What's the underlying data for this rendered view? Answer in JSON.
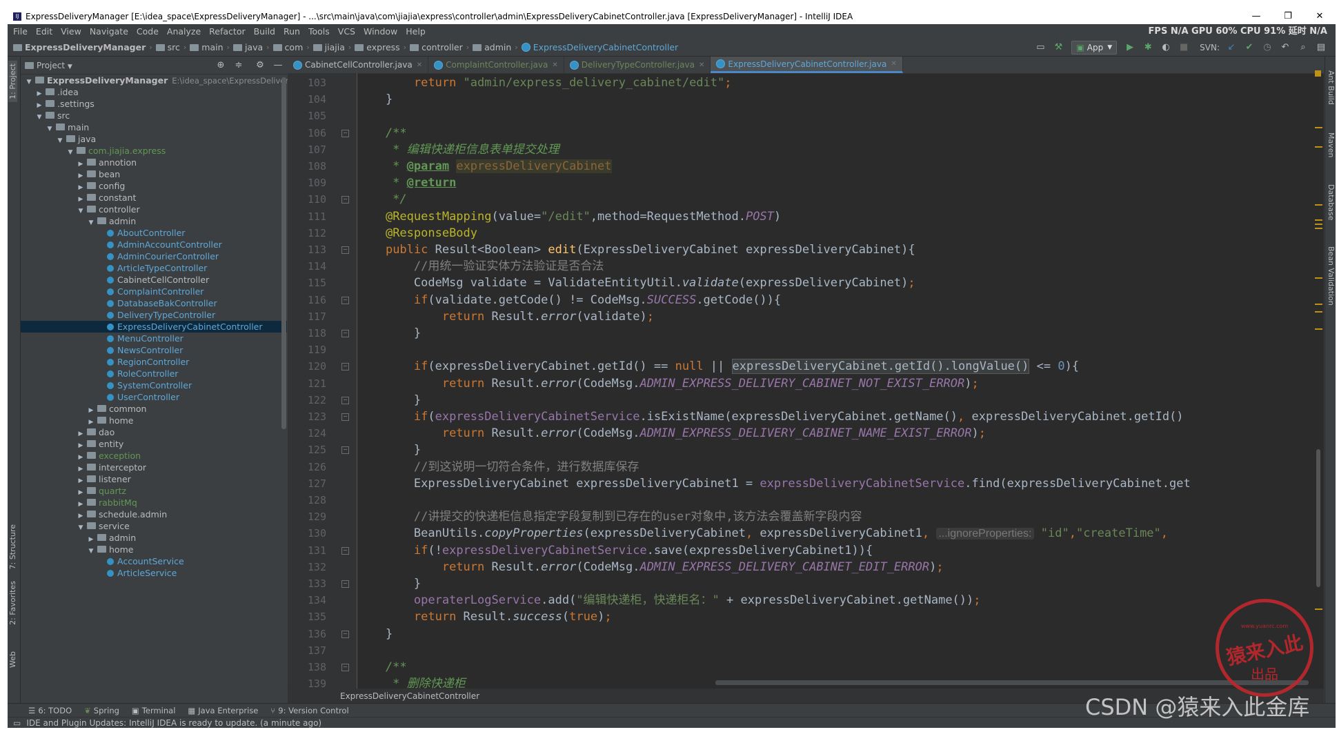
{
  "window": {
    "title": "ExpressDeliveryManager [E:\\idea_space\\ExpressDeliveryManager] - ...\\src\\main\\java\\com\\jiajia\\express\\controller\\admin\\ExpressDeliveryCabinetController.java [ExpressDeliveryManager] - IntelliJ IDEA",
    "controls": [
      "—",
      "❐",
      "✕"
    ]
  },
  "menu": [
    "File",
    "Edit",
    "View",
    "Navigate",
    "Code",
    "Analyze",
    "Refactor",
    "Build",
    "Run",
    "Tools",
    "VCS",
    "Window",
    "Help"
  ],
  "perf": "FPS N/A GPU 60% CPU 91% 延时 N/A",
  "nav": {
    "crumbs": [
      "ExpressDeliveryManager",
      "src",
      "main",
      "java",
      "com",
      "jiajia",
      "express",
      "controller",
      "admin",
      "ExpressDeliveryCabinetController"
    ],
    "run_config": "App",
    "svn_label": "SVN:"
  },
  "project": {
    "title": "Project",
    "tree": [
      {
        "level": 0,
        "label": "ExpressDeliveryManager",
        "extra": "E:\\idea_space\\ExpressDeliveryManager",
        "kind": "module",
        "open": true
      },
      {
        "level": 1,
        "label": ".idea",
        "kind": "folder",
        "open": false
      },
      {
        "level": 1,
        "label": ".settings",
        "kind": "folder",
        "open": false
      },
      {
        "level": 1,
        "label": "src",
        "kind": "folder",
        "open": true
      },
      {
        "level": 2,
        "label": "main",
        "kind": "folder",
        "open": true
      },
      {
        "level": 3,
        "label": "java",
        "kind": "folder",
        "open": true
      },
      {
        "level": 4,
        "label": "com.jiajia.express",
        "kind": "package",
        "open": true,
        "color": "green"
      },
      {
        "level": 5,
        "label": "annotion",
        "kind": "folder",
        "open": false
      },
      {
        "level": 5,
        "label": "bean",
        "kind": "folder",
        "open": false
      },
      {
        "level": 5,
        "label": "config",
        "kind": "folder",
        "open": false
      },
      {
        "level": 5,
        "label": "constant",
        "kind": "folder",
        "open": false
      },
      {
        "level": 5,
        "label": "controller",
        "kind": "folder",
        "open": true
      },
      {
        "level": 6,
        "label": "admin",
        "kind": "folder",
        "open": true
      },
      {
        "level": 7,
        "label": "AboutController",
        "kind": "class",
        "color": "green"
      },
      {
        "level": 7,
        "label": "AdminAccountController",
        "kind": "class",
        "color": "green"
      },
      {
        "level": 7,
        "label": "AdminCourierController",
        "kind": "class",
        "color": "green"
      },
      {
        "level": 7,
        "label": "ArticleTypeController",
        "kind": "class",
        "color": "green"
      },
      {
        "level": 7,
        "label": "CabinetCellController",
        "kind": "class",
        "color": "plain"
      },
      {
        "level": 7,
        "label": "ComplaintController",
        "kind": "class",
        "color": "green"
      },
      {
        "level": 7,
        "label": "DatabaseBakController",
        "kind": "class",
        "color": "green"
      },
      {
        "level": 7,
        "label": "DeliveryTypeController",
        "kind": "class",
        "color": "green"
      },
      {
        "level": 7,
        "label": "ExpressDeliveryCabinetController",
        "kind": "class",
        "color": "green",
        "selected": true
      },
      {
        "level": 7,
        "label": "MenuController",
        "kind": "class",
        "color": "green"
      },
      {
        "level": 7,
        "label": "NewsController",
        "kind": "class",
        "color": "green"
      },
      {
        "level": 7,
        "label": "RegionController",
        "kind": "class",
        "color": "green"
      },
      {
        "level": 7,
        "label": "RoleController",
        "kind": "class",
        "color": "green"
      },
      {
        "level": 7,
        "label": "SystemController",
        "kind": "class",
        "color": "green"
      },
      {
        "level": 7,
        "label": "UserController",
        "kind": "class",
        "color": "green"
      },
      {
        "level": 6,
        "label": "common",
        "kind": "folder",
        "open": false
      },
      {
        "level": 6,
        "label": "home",
        "kind": "folder",
        "open": false
      },
      {
        "level": 5,
        "label": "dao",
        "kind": "folder",
        "open": false
      },
      {
        "level": 5,
        "label": "entity",
        "kind": "folder",
        "open": false
      },
      {
        "level": 5,
        "label": "exception",
        "kind": "folder",
        "open": false,
        "color": "green"
      },
      {
        "level": 5,
        "label": "interceptor",
        "kind": "folder",
        "open": false
      },
      {
        "level": 5,
        "label": "listener",
        "kind": "folder",
        "open": false
      },
      {
        "level": 5,
        "label": "quartz",
        "kind": "folder",
        "open": false,
        "color": "green"
      },
      {
        "level": 5,
        "label": "rabbitMq",
        "kind": "folder",
        "open": false,
        "color": "green"
      },
      {
        "level": 5,
        "label": "schedule.admin",
        "kind": "folder",
        "open": false
      },
      {
        "level": 5,
        "label": "service",
        "kind": "folder",
        "open": true
      },
      {
        "level": 6,
        "label": "admin",
        "kind": "folder",
        "open": false
      },
      {
        "level": 6,
        "label": "home",
        "kind": "folder",
        "open": true
      },
      {
        "level": 7,
        "label": "AccountService",
        "kind": "class",
        "color": "green"
      },
      {
        "level": 7,
        "label": "ArticleService",
        "kind": "class",
        "color": "green"
      }
    ]
  },
  "left_tool_tabs": [
    "1: Project",
    "7: Structure",
    "2: Favorites",
    "Web"
  ],
  "right_tool_tabs": [
    "Ant Build",
    "Maven",
    "Database",
    "Bean Validation"
  ],
  "editor": {
    "tabs": [
      {
        "label": "CabinetCellController.java",
        "active": false
      },
      {
        "label": "ComplaintController.java",
        "active": false
      },
      {
        "label": "DeliveryTypeController.java",
        "active": false
      },
      {
        "label": "ExpressDeliveryCabinetController.java",
        "active": true
      }
    ],
    "line_numbers": [
      "103",
      "104",
      "105",
      "106",
      "107",
      "108",
      "109",
      "110",
      "111",
      "112",
      "113",
      "114",
      "115",
      "116",
      "117",
      "118",
      "119",
      "120",
      "121",
      "122",
      "123",
      "124",
      "125",
      "126",
      "127",
      "128",
      "129",
      "130",
      "131",
      "132",
      "133",
      "134",
      "135",
      "136",
      "137",
      "138",
      "139"
    ],
    "code_lines": [
      [
        [
          "        ",
          ""
        ],
        [
          "return ",
          "kw"
        ],
        [
          "\"admin/express_delivery_cabinet/edit\"",
          "str"
        ],
        [
          ";",
          "kw"
        ]
      ],
      [
        [
          "    }",
          ""
        ]
      ],
      [],
      [
        [
          "    /**",
          "doc"
        ]
      ],
      [
        [
          "     * 编辑快递柜信息表单提交处理",
          "doc"
        ]
      ],
      [
        [
          "     * ",
          "doc"
        ],
        [
          "@param",
          "doctag"
        ],
        [
          " ",
          "doc"
        ],
        [
          "expressDeliveryCabinet",
          "docparam"
        ]
      ],
      [
        [
          "     * ",
          "doc"
        ],
        [
          "@return",
          "doctag"
        ]
      ],
      [
        [
          "     */",
          "doc"
        ]
      ],
      [
        [
          "    ",
          ""
        ],
        [
          "@RequestMapping",
          "ann"
        ],
        [
          "(value=",
          ""
        ],
        [
          "\"/edit\"",
          "str"
        ],
        [
          ",method=RequestMethod.",
          ""
        ],
        [
          "POST",
          "fieldi"
        ],
        [
          ")",
          ""
        ]
      ],
      [
        [
          "    ",
          ""
        ],
        [
          "@ResponseBody",
          "ann"
        ]
      ],
      [
        [
          "    ",
          ""
        ],
        [
          "public ",
          "kw"
        ],
        [
          "Result<Boolean> ",
          ""
        ],
        [
          "edit",
          "method"
        ],
        [
          "(ExpressDeliveryCabinet expressDeliveryCabinet){",
          ""
        ]
      ],
      [
        [
          "        //用统一验证实体方法验证是否合法",
          "cmt"
        ]
      ],
      [
        [
          "        CodeMsg validate = ValidateEntityUtil.",
          ""
        ],
        [
          "validate",
          "static"
        ],
        [
          "(expressDeliveryCabinet)",
          ""
        ],
        [
          ";",
          "kw"
        ]
      ],
      [
        [
          "        ",
          ""
        ],
        [
          "if",
          "kw"
        ],
        [
          "(validate.getCode() != CodeMsg.",
          ""
        ],
        [
          "SUCCESS",
          "fieldi"
        ],
        [
          ".getCode()){",
          ""
        ]
      ],
      [
        [
          "            ",
          ""
        ],
        [
          "return ",
          "kw"
        ],
        [
          "Result.",
          ""
        ],
        [
          "error",
          "static"
        ],
        [
          "(validate)",
          ""
        ],
        [
          ";",
          "kw"
        ]
      ],
      [
        [
          "        }",
          ""
        ]
      ],
      [],
      [
        [
          "        ",
          ""
        ],
        [
          "if",
          "kw"
        ],
        [
          "(expressDeliveryCabinet.getId() == ",
          ""
        ],
        [
          "null",
          "kw"
        ],
        [
          " || ",
          ""
        ],
        [
          "expressDeliveryCabinet.getId().longValue()",
          "hl"
        ],
        [
          " <= ",
          ""
        ],
        [
          "0",
          "num"
        ],
        [
          "){",
          ""
        ]
      ],
      [
        [
          "            ",
          ""
        ],
        [
          "return ",
          "kw"
        ],
        [
          "Result.",
          ""
        ],
        [
          "error",
          "static"
        ],
        [
          "(CodeMsg.",
          ""
        ],
        [
          "ADMIN_EXPRESS_DELIVERY_CABINET_NOT_EXIST_ERROR",
          "fieldi"
        ],
        [
          ")",
          ""
        ],
        [
          ";",
          "kw"
        ]
      ],
      [
        [
          "        }",
          ""
        ]
      ],
      [
        [
          "        ",
          ""
        ],
        [
          "if",
          "kw"
        ],
        [
          "(",
          ""
        ],
        [
          "expressDeliveryCabinetService",
          "field"
        ],
        [
          ".isExistName(expressDeliveryCabinet.getName()",
          ""
        ],
        [
          ", ",
          "kw"
        ],
        [
          "expressDeliveryCabinet.getId()",
          ""
        ]
      ],
      [
        [
          "            ",
          ""
        ],
        [
          "return ",
          "kw"
        ],
        [
          "Result.",
          ""
        ],
        [
          "error",
          "static"
        ],
        [
          "(CodeMsg.",
          ""
        ],
        [
          "ADMIN_EXPRESS_DELIVERY_CABINET_NAME_EXIST_ERROR",
          "fieldi"
        ],
        [
          ")",
          ""
        ],
        [
          ";",
          "kw"
        ]
      ],
      [
        [
          "        }",
          ""
        ]
      ],
      [
        [
          "        //到这说明一切符合条件，进行数据库保存",
          "cmt"
        ]
      ],
      [
        [
          "        ExpressDeliveryCabinet expressDeliveryCabinet1 = ",
          ""
        ],
        [
          "expressDeliveryCabinetService",
          "field"
        ],
        [
          ".find(expressDeliveryCabinet.get",
          ""
        ]
      ],
      [],
      [
        [
          "        //讲提交的快递柜信息指定字段复制到已存在的user对象中,该方法会覆盖新字段内容",
          "cmt"
        ]
      ],
      [
        [
          "        BeanUtils.",
          ""
        ],
        [
          "copyProperties",
          "static"
        ],
        [
          "(expressDeliveryCabinet",
          ""
        ],
        [
          ", ",
          "kw"
        ],
        [
          "expressDeliveryCabinet1",
          ""
        ],
        [
          ", ",
          "kw"
        ],
        [
          "...ignoreProperties:",
          "hint"
        ],
        [
          " ",
          ""
        ],
        [
          "\"id\"",
          "str"
        ],
        [
          ",",
          "kw"
        ],
        [
          "\"createTime\"",
          "str"
        ],
        [
          ",",
          "kw"
        ]
      ],
      [
        [
          "        ",
          ""
        ],
        [
          "if",
          "kw"
        ],
        [
          "(!",
          ""
        ],
        [
          "expressDeliveryCabinetService",
          "field"
        ],
        [
          ".save(expressDeliveryCabinet1)){",
          ""
        ]
      ],
      [
        [
          "            ",
          ""
        ],
        [
          "return ",
          "kw"
        ],
        [
          "Result.",
          ""
        ],
        [
          "error",
          "static"
        ],
        [
          "(CodeMsg.",
          ""
        ],
        [
          "ADMIN_EXPRESS_DELIVERY_CABINET_EDIT_ERROR",
          "fieldi"
        ],
        [
          ")",
          ""
        ],
        [
          ";",
          "kw"
        ]
      ],
      [
        [
          "        }",
          ""
        ]
      ],
      [
        [
          "        ",
          ""
        ],
        [
          "operaterLogService",
          "field"
        ],
        [
          ".add(",
          ""
        ],
        [
          "\"编辑快递柜，快递柜名：\"",
          "str"
        ],
        [
          " + expressDeliveryCabinet.getName())",
          ""
        ],
        [
          ";",
          "kw"
        ]
      ],
      [
        [
          "        ",
          ""
        ],
        [
          "return ",
          "kw"
        ],
        [
          "Result.",
          ""
        ],
        [
          "success",
          "static"
        ],
        [
          "(",
          ""
        ],
        [
          "true",
          "kw"
        ],
        [
          ")",
          ""
        ],
        [
          ";",
          "kw"
        ]
      ],
      [
        [
          "    }",
          ""
        ]
      ],
      [],
      [
        [
          "    /**",
          "doc"
        ]
      ],
      [
        [
          "     * 删除快递柜",
          "doc"
        ]
      ]
    ],
    "breadcrumb": "ExpressDeliveryCabinetController"
  },
  "bottom_tabs": [
    "6: TODO",
    "Spring",
    "Terminal",
    "Java Enterprise",
    "9: Version Control"
  ],
  "status": "IDE and Plugin Updates: IntelliJ IDEA is ready to update. (a minute ago)",
  "watermark": "CSDN @猿来入此金库",
  "stamp_text": "猿来入此",
  "stamp_sub": "出品",
  "stamp_url": "www.yuanrc.com",
  "colors": {
    "keyword": "#cc7832",
    "string": "#6a8759",
    "field": "#9876aa",
    "background": "#2b2b2b",
    "selected": "#0d293e"
  }
}
